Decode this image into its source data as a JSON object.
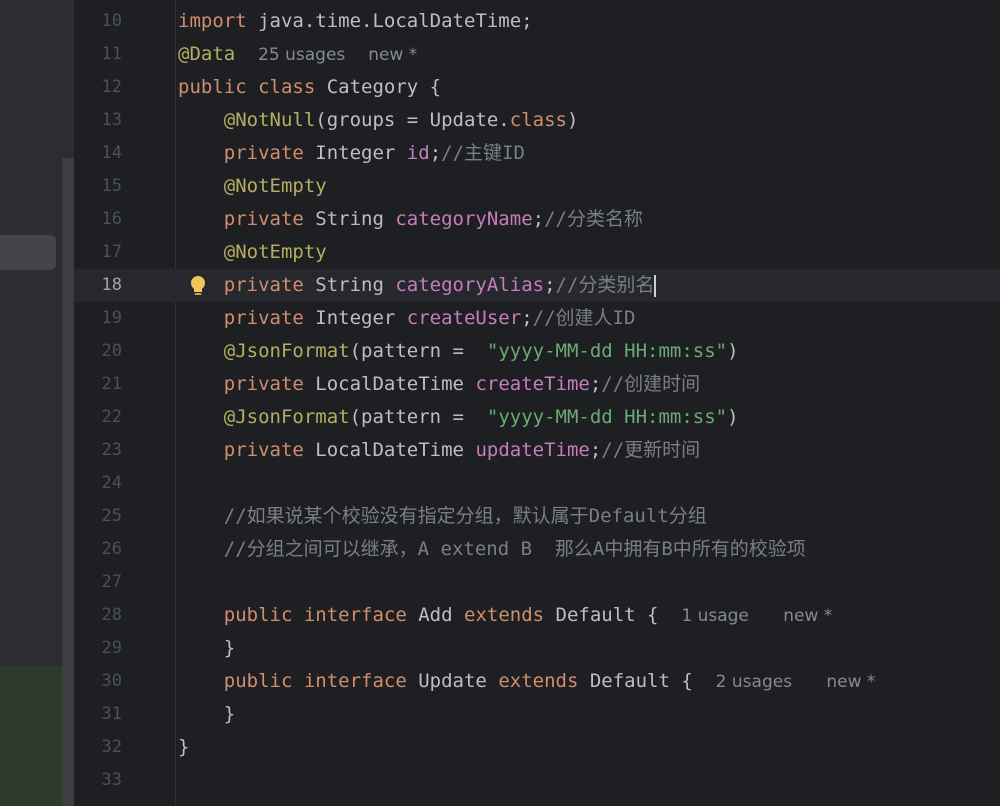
{
  "editor": {
    "current_line": "18",
    "lines": [
      {
        "num": "10",
        "parts": [
          {
            "t": "import",
            "c": "kw"
          },
          {
            "t": " java.time.LocalDateTime;"
          }
        ]
      },
      {
        "num": "11",
        "parts": [
          {
            "t": "@Data",
            "c": "ann"
          },
          {
            "t": "  "
          },
          {
            "t": "25 usages",
            "c": "hint"
          },
          {
            "t": "  "
          },
          {
            "t": "new *",
            "c": "hint"
          }
        ]
      },
      {
        "num": "12",
        "parts": [
          {
            "t": "public class",
            "c": "kw"
          },
          {
            "t": " Category {"
          }
        ]
      },
      {
        "num": "13",
        "parts": [
          {
            "t": "    "
          },
          {
            "t": "@NotNull",
            "c": "ann"
          },
          {
            "t": "(groups = Update."
          },
          {
            "t": "class",
            "c": "kw"
          },
          {
            "t": ")"
          }
        ]
      },
      {
        "num": "14",
        "parts": [
          {
            "t": "    "
          },
          {
            "t": "private",
            "c": "kw"
          },
          {
            "t": " Integer "
          },
          {
            "t": "id",
            "c": "field"
          },
          {
            "t": ";"
          },
          {
            "t": "//主键ID",
            "c": "cmt"
          }
        ]
      },
      {
        "num": "15",
        "parts": [
          {
            "t": "    "
          },
          {
            "t": "@NotEmpty",
            "c": "ann"
          }
        ]
      },
      {
        "num": "16",
        "parts": [
          {
            "t": "    "
          },
          {
            "t": "private",
            "c": "kw"
          },
          {
            "t": " String "
          },
          {
            "t": "categoryName",
            "c": "field"
          },
          {
            "t": ";"
          },
          {
            "t": "//分类名称",
            "c": "cmt"
          }
        ]
      },
      {
        "num": "17",
        "parts": [
          {
            "t": "    "
          },
          {
            "t": "@NotEmpty",
            "c": "ann"
          }
        ]
      },
      {
        "num": "18",
        "parts": [
          {
            "t": "    "
          },
          {
            "t": "private",
            "c": "kw"
          },
          {
            "t": " String "
          },
          {
            "t": "categoryAlias",
            "c": "field"
          },
          {
            "t": ";"
          },
          {
            "t": "//分类别名",
            "c": "cmt"
          }
        ]
      },
      {
        "num": "19",
        "parts": [
          {
            "t": "    "
          },
          {
            "t": "private",
            "c": "kw"
          },
          {
            "t": " Integer "
          },
          {
            "t": "createUser",
            "c": "field"
          },
          {
            "t": ";"
          },
          {
            "t": "//创建人ID",
            "c": "cmt"
          }
        ]
      },
      {
        "num": "20",
        "parts": [
          {
            "t": "    "
          },
          {
            "t": "@JsonFormat",
            "c": "ann"
          },
          {
            "t": "(pattern =  "
          },
          {
            "t": "\"yyyy-MM-dd HH:mm:ss\"",
            "c": "str"
          },
          {
            "t": ")"
          }
        ]
      },
      {
        "num": "21",
        "parts": [
          {
            "t": "    "
          },
          {
            "t": "private",
            "c": "kw"
          },
          {
            "t": " LocalDateTime "
          },
          {
            "t": "createTime",
            "c": "field"
          },
          {
            "t": ";"
          },
          {
            "t": "//创建时间",
            "c": "cmt"
          }
        ]
      },
      {
        "num": "22",
        "parts": [
          {
            "t": "    "
          },
          {
            "t": "@JsonFormat",
            "c": "ann"
          },
          {
            "t": "(pattern =  "
          },
          {
            "t": "\"yyyy-MM-dd HH:mm:ss\"",
            "c": "str"
          },
          {
            "t": ")"
          }
        ]
      },
      {
        "num": "23",
        "parts": [
          {
            "t": "    "
          },
          {
            "t": "private",
            "c": "kw"
          },
          {
            "t": " LocalDateTime "
          },
          {
            "t": "updateTime",
            "c": "field"
          },
          {
            "t": ";"
          },
          {
            "t": "//更新时间",
            "c": "cmt"
          }
        ]
      },
      {
        "num": "24",
        "parts": []
      },
      {
        "num": "25",
        "parts": [
          {
            "t": "    "
          },
          {
            "t": "//如果说某个校验没有指定分组，默认属于Default分组",
            "c": "cmt"
          }
        ]
      },
      {
        "num": "26",
        "parts": [
          {
            "t": "    "
          },
          {
            "t": "//分组之间可以继承，A extend B  那么A中拥有B中所有的校验项",
            "c": "cmt"
          }
        ]
      },
      {
        "num": "27",
        "parts": []
      },
      {
        "num": "28",
        "parts": [
          {
            "t": "    "
          },
          {
            "t": "public interface",
            "c": "kw"
          },
          {
            "t": " Add "
          },
          {
            "t": "extends",
            "c": "kw"
          },
          {
            "t": " Default {  "
          },
          {
            "t": "1 usage",
            "c": "hint"
          },
          {
            "t": "   "
          },
          {
            "t": "new *",
            "c": "hint"
          }
        ]
      },
      {
        "num": "29",
        "parts": [
          {
            "t": "    }"
          }
        ]
      },
      {
        "num": "30",
        "parts": [
          {
            "t": "    "
          },
          {
            "t": "public interface",
            "c": "kw"
          },
          {
            "t": " Update "
          },
          {
            "t": "extends",
            "c": "kw"
          },
          {
            "t": " Default {  "
          },
          {
            "t": "2 usages",
            "c": "hint"
          },
          {
            "t": "   "
          },
          {
            "t": "new *",
            "c": "hint"
          }
        ]
      },
      {
        "num": "31",
        "parts": [
          {
            "t": "    }"
          }
        ]
      },
      {
        "num": "32",
        "parts": [
          {
            "t": "}"
          }
        ]
      },
      {
        "num": "33",
        "parts": []
      }
    ]
  }
}
